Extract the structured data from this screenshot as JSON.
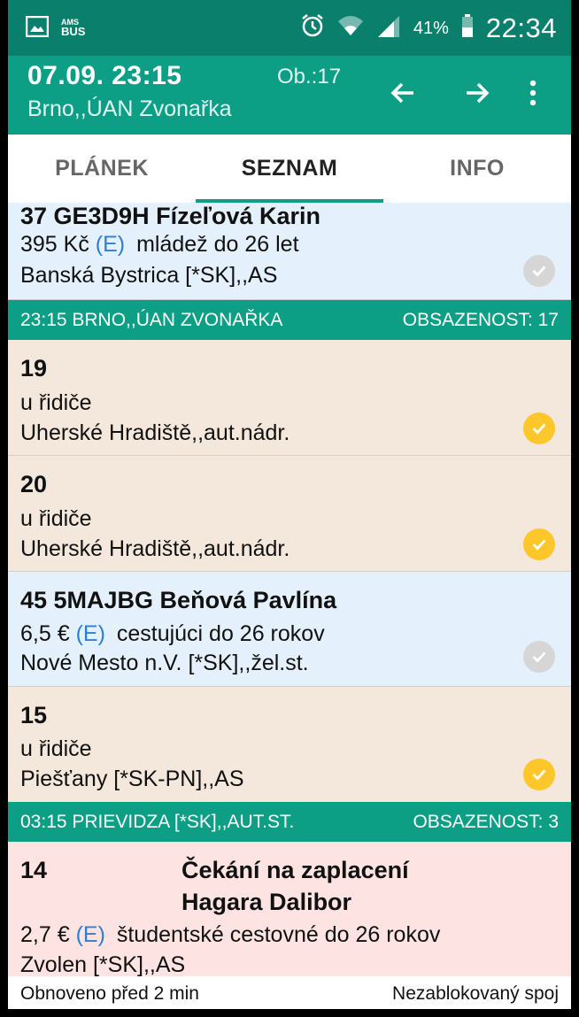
{
  "status_bar": {
    "left_icons": [
      "image-icon",
      "amsbus-icon"
    ],
    "battery": "41%",
    "time": "22:34"
  },
  "app_bar": {
    "title": "07.09. 23:15",
    "subtitle": "Brno,,ÚAN Zvonařka",
    "occupancy": "Ob.:17"
  },
  "tabs": [
    "PLÁNEK",
    "SEZNAM",
    "INFO"
  ],
  "active_tab": "SEZNAM",
  "rows": [
    {
      "title": "37  GE3D9H  Fízeľová Karin",
      "price": "395 Kč",
      "e": "(E)",
      "desc": "mládež do 26 let",
      "stop": "Banská Bystrica [*SK],,AS",
      "check": "grey"
    },
    {
      "title": "19",
      "line2": "u řidiče",
      "stop": "Uherské Hradiště,,aut.nádr.",
      "check": "yellow"
    },
    {
      "title": "20",
      "line2": "u řidiče",
      "stop": "Uherské Hradiště,,aut.nádr.",
      "check": "yellow"
    },
    {
      "title": "45  5MAJBG  Beňová Pavlína",
      "price": "6,5 €",
      "e": "(E)",
      "desc": "cestujúci do 26 rokov",
      "stop": "Nové Mesto n.V. [*SK],,žel.st.",
      "check": "grey"
    },
    {
      "title": "15",
      "line2": "u řidiče",
      "stop": "Piešťany [*SK-PN],,AS",
      "check": "yellow"
    },
    {
      "title": "14",
      "title_right_1": "Čekání na zaplacení",
      "title_right_2": "Hagara Dalibor",
      "price": "2,7 €",
      "e": "(E)",
      "desc": "študentské cestovné do 26 rokov",
      "stop": "Zvolen [*SK],,AS"
    }
  ],
  "sections": [
    {
      "left": "23:15 BRNO,,ÚAN ZVONAŘKA",
      "right": "OBSAZENOST: 17"
    },
    {
      "left": "03:15 PRIEVIDZA [*SK],,AUT.ST.",
      "right": "OBSAZENOST: 3"
    }
  ],
  "footer": {
    "left": "Obnoveno před 2 min",
    "right": "Nezablokovaný spoj"
  },
  "colors": {
    "status_bar": "#0a7f6c",
    "app_bar": "#0d9f85",
    "accent": "#0d9f85",
    "blue_row": "#e4f0fb",
    "beige_row": "#f4e7dc",
    "pink_row": "#fde4e2",
    "check_yellow": "#fdc72c",
    "check_grey": "#d6d6d6",
    "e_badge": "#2f7fd0"
  }
}
